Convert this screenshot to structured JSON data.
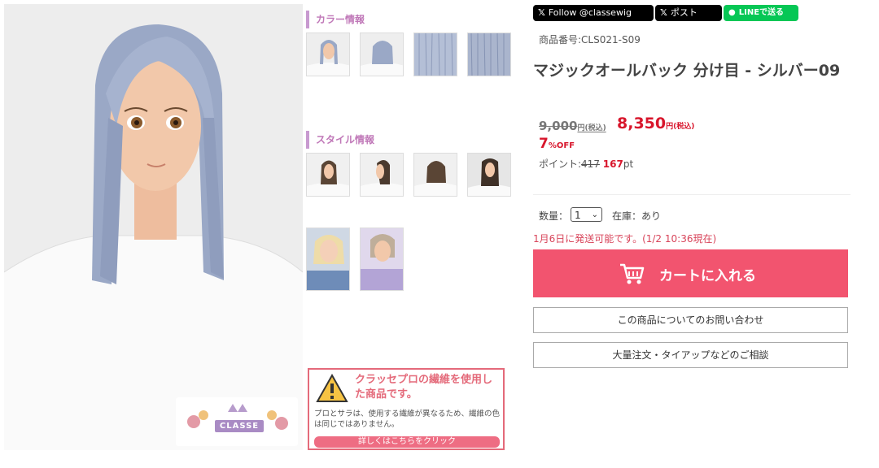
{
  "images": {
    "main_alt": "Silver-blue straight bob wig on mannequin",
    "logo_text": "CLASSE"
  },
  "sections": {
    "color_info": "カラー情報",
    "style_info": "スタイル情報"
  },
  "notice": {
    "title": "クラッセプロの繊維を使用した商品です。",
    "body": "プロとサラは、使用する繊維が異なるため、繊維の色は同じではありません。",
    "link": "詳しくはこちらをクリック"
  },
  "social": {
    "x_follow": "Follow @classewig",
    "x_post": "ポスト",
    "line": "LINEで送る"
  },
  "product": {
    "code": "商品番号:CLS021-S09",
    "title": "マジックオールバック 分け目 - シルバー09",
    "original_price": "9,000",
    "original_suffix": "円(税込)",
    "sale_price": "8,350",
    "sale_suffix": "円(税込)",
    "discount_value": "7",
    "discount_suffix": "%OFF",
    "points_label": "ポイント:",
    "points_original": "417",
    "points_value": "167",
    "points_unit": "pt"
  },
  "purchase": {
    "qty_label": "数量：",
    "qty_value": "1",
    "stock": "在庫：あり",
    "shipping": "1月6日に発送可能です。(1/2 10:36現在)",
    "cart_button": "カートに入れる",
    "inquiry_button": "この商品についてのお問い合わせ",
    "bulk_button": "大量注文・タイアップなどのご相談"
  },
  "colors": {
    "accent": "#f2546f",
    "price_red": "#d8162c",
    "heading_purple": "#c078b8",
    "wig_silver": "#9aa8c6"
  }
}
